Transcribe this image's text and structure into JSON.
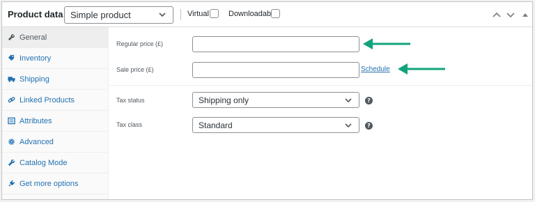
{
  "header": {
    "title": "Product data —",
    "product_type": "Simple product",
    "virtual_label": "Virtual:",
    "downloadable_label": "Downloadable:",
    "icons": [
      "chevron-up-icon",
      "chevron-down-icon",
      "collapse-triangle-icon"
    ]
  },
  "sidebar": {
    "items": [
      {
        "label": "General",
        "icon": "wrench-icon",
        "active": true
      },
      {
        "label": "Inventory",
        "icon": "tag-icon",
        "active": false
      },
      {
        "label": "Shipping",
        "icon": "truck-icon",
        "active": false
      },
      {
        "label": "Linked Products",
        "icon": "link-icon",
        "active": false
      },
      {
        "label": "Attributes",
        "icon": "list-icon",
        "active": false
      },
      {
        "label": "Advanced",
        "icon": "gear-icon",
        "active": false
      },
      {
        "label": "Catalog Mode",
        "icon": "wrench-icon",
        "active": false
      },
      {
        "label": "Get more options",
        "icon": "plugin-icon",
        "active": false
      }
    ]
  },
  "general": {
    "regular_price_label": "Regular price (£)",
    "regular_price_value": "",
    "sale_price_label": "Sale price (£)",
    "sale_price_value": "",
    "schedule_link": "Schedule",
    "tax_status_label": "Tax status",
    "tax_status_value": "Shipping only",
    "tax_class_label": "Tax class",
    "tax_class_value": "Standard",
    "help_glyph": "?"
  },
  "colors": {
    "accent_link": "#2271b1",
    "annotation_arrow": "#12a37a",
    "active_tab_bg": "#eeeeee"
  }
}
